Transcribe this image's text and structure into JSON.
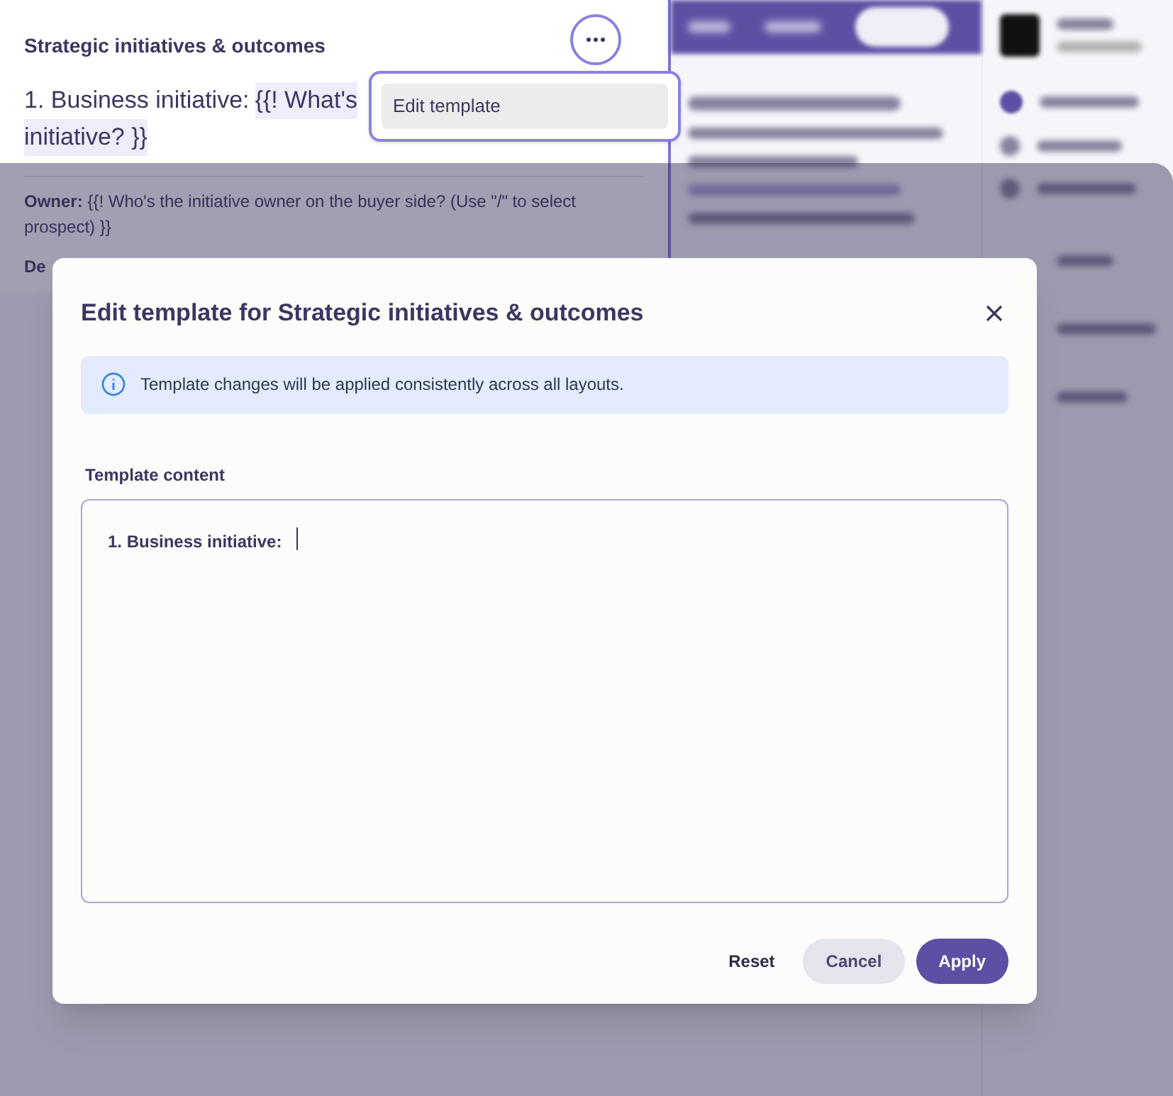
{
  "card": {
    "title": "Strategic initiatives & outcomes",
    "heading_prefix": "1. Business initiative:",
    "heading_placeholder_lines": [
      "{{! What's",
      "initiative? }}"
    ],
    "owner_text": "**Owner:**  {{! Who's the initiative owner on the buyer side? (Use \"/\" to select prospect) }}",
    "next_label": "De"
  },
  "menu": {
    "items": [
      {
        "label": "Edit template",
        "selected": true
      }
    ]
  },
  "modal": {
    "title": "Edit template for Strategic initiatives & outcomes",
    "notice": "Template changes will be applied consistently across all layouts.",
    "field_label": "Template content",
    "field_value": "1. Business initiative:",
    "buttons": [
      {
        "label": "Reset",
        "kind": "text"
      },
      {
        "label": "Cancel",
        "kind": "secondary"
      },
      {
        "label": "Apply",
        "kind": "primary"
      }
    ]
  }
}
